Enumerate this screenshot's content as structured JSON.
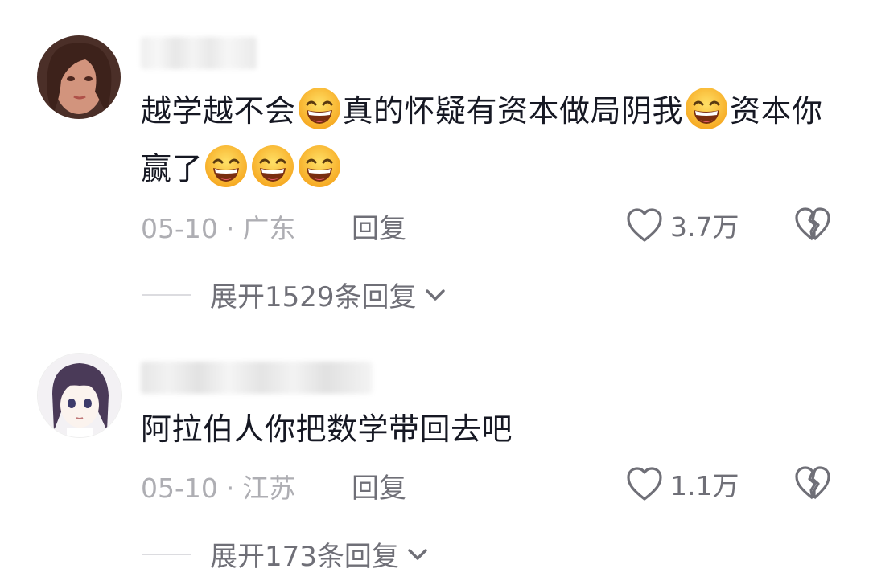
{
  "comments": [
    {
      "text_parts": [
        "越学越不会",
        "真的怀疑有资本做局阴我",
        "资本你赢了"
      ],
      "date": "05-10",
      "location": "广东",
      "reply_label": "回复",
      "likes": "3.7万",
      "expand_label": "展开1529条回复"
    },
    {
      "text": "阿拉伯人你把数学带回去吧",
      "date": "05-10",
      "location": "江苏",
      "reply_label": "回复",
      "likes": "1.1万",
      "expand_label": "展开173条回复"
    }
  ],
  "separator": "·",
  "icons": {
    "emoji": "grinning-squint-emoji",
    "like": "heart-outline-icon",
    "dislike": "broken-heart-icon",
    "expand": "chevron-down-icon"
  },
  "colors": {
    "text": "#161823",
    "meta": "#aeaeb3",
    "secondary": "#6f6f77",
    "emoji_face": "#fbc02d"
  }
}
